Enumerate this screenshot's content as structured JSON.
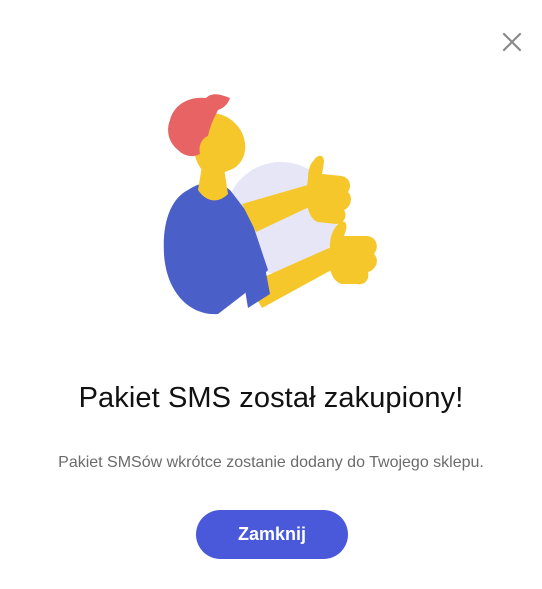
{
  "dialog": {
    "close_icon": "close-icon",
    "title": "Pakiet SMS został zakupiony!",
    "message": "Pakiet SMSów wkrótce zostanie dodany do Twojego sklepu.",
    "button_label": "Zamknij",
    "illustration": "person-thumbs-up-illustration"
  },
  "colors": {
    "button": "#4a58da",
    "shirt": "#4a5fc8",
    "skin": "#f6c72b",
    "hair": "#e86464",
    "backdrop_circle": "#e6e6f6",
    "close_icon": "#8a8a8a"
  }
}
